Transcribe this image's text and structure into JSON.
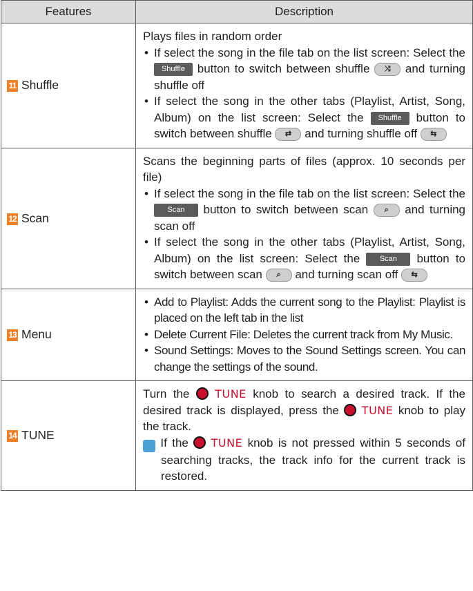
{
  "header": {
    "features": "Features",
    "description": "Description"
  },
  "rows": {
    "shuffle": {
      "num": "11",
      "feature": "Shuffle",
      "intro": "Plays files in random order",
      "b1_a": "If select the song in the file tab on the list screen: Select the",
      "b1_btn": "Shuffle",
      "b1_b": "button to switch between shuffle",
      "b1_c": "and turning shuffle off",
      "b2_a": "If select the song in the other tabs (Playlist, Artist, Song, Album) on the list screen: Select the",
      "b2_btn": "Shuffle",
      "b2_b": "button to switch between shuffle",
      "b2_c": "and turning shuffle off"
    },
    "scan": {
      "num": "12",
      "feature": "Scan",
      "intro": "Scans the beginning parts of files (approx. 10 seconds per file)",
      "b1_a": "If select the song in the file tab on the list screen: Select the",
      "b1_btn": "Scan",
      "b1_b": "button to switch between scan",
      "b1_c": "and turning scan off",
      "b2_a": "If select the song in the other tabs (Playlist, Artist, Song, Album) on the list screen: Select the",
      "b2_btn": "Scan",
      "b2_b": "button to switch between scan",
      "b2_c": "and turning scan off"
    },
    "menu": {
      "num": "13",
      "feature": "Menu",
      "b1": "Add to Playlist: Adds the current song to the Playlist: Playlist is placed on the left tab in the list",
      "b2": "Delete Current File: Deletes the current track from My Music.",
      "b3": "Sound Settings: Moves to the Sound Settings screen. You can change the settings of the sound."
    },
    "tune": {
      "num": "14",
      "feature": "TUNE",
      "p1_a": "Turn the",
      "tune_word": "TUNE",
      "p1_b": "knob to search a desired track. If the desired track is displayed, press the",
      "p1_c": "knob to play the track.",
      "note_a": "If the",
      "note_b": "knob is not pressed within 5 seconds of searching tracks, the track info for the current track is restored."
    }
  },
  "colors": {
    "number_badge": "#f07f26",
    "header_bg": "#dcdcdc",
    "button_bg": "#5b5b5b",
    "knob": "#c8102e",
    "info_icon": "#4a9fd4"
  }
}
